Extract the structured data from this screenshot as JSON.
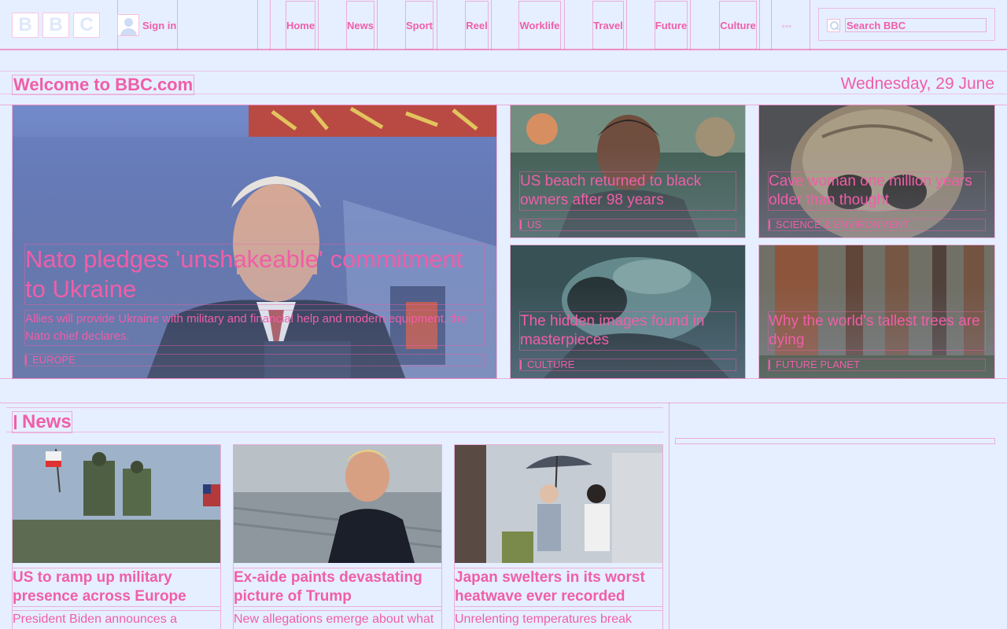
{
  "header": {
    "logo_letters": [
      "B",
      "B",
      "C"
    ],
    "signin_label": "Sign in",
    "nav": [
      "Home",
      "News",
      "Sport",
      "Reel",
      "Worklife",
      "Travel",
      "Future",
      "Culture"
    ],
    "more_label": "▫▫▫",
    "search_placeholder": "Search BBC"
  },
  "welcome": {
    "title": "Welcome to BBC.com",
    "date": "Wednesday, 29 June"
  },
  "hero": {
    "main": {
      "title": "Nato pledges 'unshakeable' commitment to Ukraine",
      "summary": "Allies will provide Ukraine with military and financial help and modern equipment, the Nato chief declares.",
      "tag": "EUROPE"
    },
    "cards": [
      {
        "title": "US beach returned to black owners after 98 years",
        "tag": "US"
      },
      {
        "title": "Cave woman one million years older than thought",
        "tag": "SCIENCE & ENVIRONMENT"
      },
      {
        "title": "The hidden images found in masterpieces",
        "tag": "CULTURE"
      },
      {
        "title": "Why the world's tallest trees are dying",
        "tag": "FUTURE PLANET"
      }
    ]
  },
  "news": {
    "heading": "News",
    "items": [
      {
        "title": "US to ramp up military presence across Europe",
        "summary": "President Biden announces a"
      },
      {
        "title": "Ex-aide paints devastating picture of Trump",
        "summary": "New allegations emerge about what"
      },
      {
        "title": "Japan swelters in its worst heatwave ever recorded",
        "summary": "Unrelenting temperatures break"
      }
    ]
  }
}
